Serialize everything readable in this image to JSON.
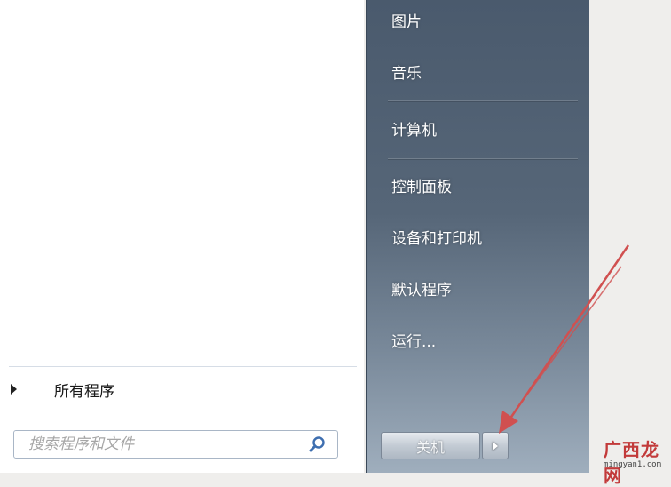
{
  "start_menu": {
    "right_items": [
      {
        "label": "图片"
      },
      {
        "label": "音乐"
      },
      {
        "label": "计算机"
      },
      {
        "label": "控制面板"
      },
      {
        "label": "设备和打印机"
      },
      {
        "label": "默认程序"
      },
      {
        "label": "运行..."
      }
    ],
    "all_programs_label": "所有程序",
    "search_placeholder": "搜索程序和文件",
    "shutdown_label": "关机"
  },
  "watermark": {
    "title": "广西龙网",
    "url": "mingyan1.com"
  },
  "colors": {
    "annotation_arrow": "#d05050",
    "right_pane_top": "#4a5a6d",
    "right_pane_bottom": "#9faebd"
  }
}
